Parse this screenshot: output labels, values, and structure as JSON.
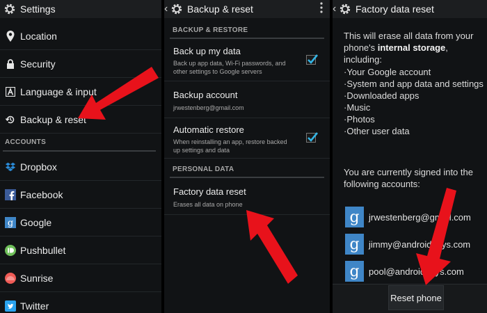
{
  "colors": {
    "accent": "#33b5e5",
    "arrow": "#e8121b",
    "google_blue": "#3f86c7"
  },
  "settings_panel": {
    "title": "Settings",
    "items": [
      {
        "label": "Location",
        "icon": "location-pin-icon"
      },
      {
        "label": "Security",
        "icon": "lock-icon"
      },
      {
        "label": "Language & input",
        "icon": "keyboard-a-icon"
      },
      {
        "label": "Backup & reset",
        "icon": "restore-icon"
      }
    ],
    "accounts_header": "ACCOUNTS",
    "accounts": [
      {
        "label": "Dropbox",
        "icon": "dropbox-icon"
      },
      {
        "label": "Facebook",
        "icon": "facebook-icon"
      },
      {
        "label": "Google",
        "icon": "google-icon"
      },
      {
        "label": "Pushbullet",
        "icon": "pushbullet-icon"
      },
      {
        "label": "Sunrise",
        "icon": "sunrise-icon"
      },
      {
        "label": "Twitter",
        "icon": "twitter-icon"
      }
    ]
  },
  "backup_panel": {
    "title": "Backup & reset",
    "section_backup": "BACKUP & RESTORE",
    "backup_my_data": {
      "title": "Back up my data",
      "summary": "Back up app data, Wi-Fi passwords, and other settings to Google servers",
      "checked": true
    },
    "backup_account": {
      "title": "Backup account",
      "summary": "jrwestenberg@gmail.com"
    },
    "auto_restore": {
      "title": "Automatic restore",
      "summary": "When reinstalling an app, restore backed up settings and data",
      "checked": true
    },
    "section_personal": "PERSONAL DATA",
    "factory_reset": {
      "title": "Factory data reset",
      "summary": "Erases all data on phone"
    }
  },
  "factory_panel": {
    "title": "Factory data reset",
    "intro_1": "This will erase all data from your phone's ",
    "intro_bold": "internal storage",
    "intro_2": ", including:",
    "list": [
      "·Your Google account",
      "·System and app data and settings",
      "·Downloaded apps",
      "·Music",
      "·Photos",
      "·Other user data"
    ],
    "signed_in_1": "You are currently signed into the",
    "signed_in_2": "following accounts:",
    "accounts": [
      "jrwestenberg@gmail.com",
      "jimmy@androidguys.com",
      "pool@androidguys.com"
    ],
    "reset_button": "Reset phone"
  }
}
